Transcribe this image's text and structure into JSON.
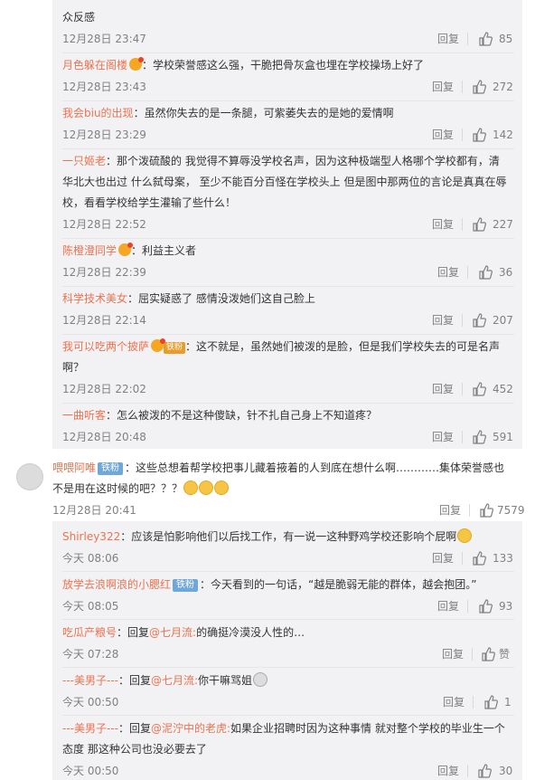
{
  "comments": [
    {
      "user": "",
      "text": "众反感",
      "time": "12月28日 23:47",
      "reply": "回复",
      "likes": "85"
    },
    {
      "user": "月色躲在阁楼",
      "text": "：学校荣誉感这么强，干脆把骨灰盒也埋在学校操场上好了",
      "time": "12月28日 23:43",
      "reply": "回复",
      "likes": "272"
    },
    {
      "user": "我会biu的出现",
      "text": "：虽然你失去的是一条腿，可紫萎失去的是她的爱情啊",
      "time": "12月28日 23:29",
      "reply": "回复",
      "likes": "142"
    },
    {
      "user": "一只姬老",
      "text": "：那个泼硫酸的 我觉得不算辱没学校名声，因为这种极端型人格哪个学校都有，清华北大也出过 什么弑母案， 至少不能百分百怪在学校头上 但是图中那两位的言论是真真在辱校，看看学校给学生灌输了些什么！",
      "time": "12月28日 22:52",
      "reply": "回复",
      "likes": "227"
    },
    {
      "user": "陈橙澄同学",
      "text": "：利益主义者",
      "time": "12月28日 22:39",
      "reply": "回复",
      "likes": "36"
    },
    {
      "user": "科学技术美女",
      "text": "：屈实疑惑了 感情没泼她们这自己脸上",
      "time": "12月28日 22:14",
      "reply": "回复",
      "likes": "207"
    },
    {
      "user": "我可以吃两个披萨",
      "badge": "铁粉",
      "text": "：这不就是，虽然她们被泼的是脸，但是我们学校失去的可是名声啊？",
      "time": "12月28日 22:02",
      "reply": "回复",
      "likes": "452"
    },
    {
      "user": "一曲听客",
      "text": "：怎么被泼的不是这种傻缺，针不扎自己身上不知道疼？",
      "time": "12月28日 20:48",
      "reply": "回复",
      "likes": "591"
    }
  ],
  "main_comment": {
    "user": "喂喂阿唯",
    "badge": "铁粉",
    "text": "：这些总想着帮学校把事儿藏着掖着的人到底在想什么啊…………集体荣誉感也不是用在这时候的吧？？？",
    "time": "12月28日 20:41",
    "reply": "回复",
    "likes": "7579"
  },
  "replies": [
    {
      "user": "Shirley322",
      "text": "：应该是怕影响他们以后找工作，有一说一这种野鸡学校还影响个屁啊",
      "time": "今天 08:06",
      "reply": "回复",
      "likes": "133"
    },
    {
      "user": "放学去浪啊浪的小腮红",
      "badge": "铁粉",
      "text": "：今天看到的一句话，“越是脆弱无能的群体，越会抱团。”",
      "time": "今天 08:05",
      "reply": "回复",
      "likes": "93"
    },
    {
      "user": "吃瓜产粮号",
      "pre": "：回复",
      "mention": "@七月流:",
      "text": "的确挺冷漠没人性的…",
      "time": "今天 07:28",
      "reply": "回复",
      "likes": "赞"
    },
    {
      "user": "---美男子---",
      "pre": "：回复",
      "mention": "@七月流:",
      "text": "你干嘛骂姐",
      "time": "今天 00:50",
      "reply": "回复",
      "likes": "1"
    },
    {
      "user": "---美男子---",
      "pre": "：回复",
      "mention": "@泥泞中的老虎:",
      "text": "如果企业招聘时因为这种事情 就对整个学校的毕业生一个态度 那这种公司也没必要去了",
      "time": "今天 00:50",
      "reply": "回复",
      "likes": "30"
    }
  ]
}
